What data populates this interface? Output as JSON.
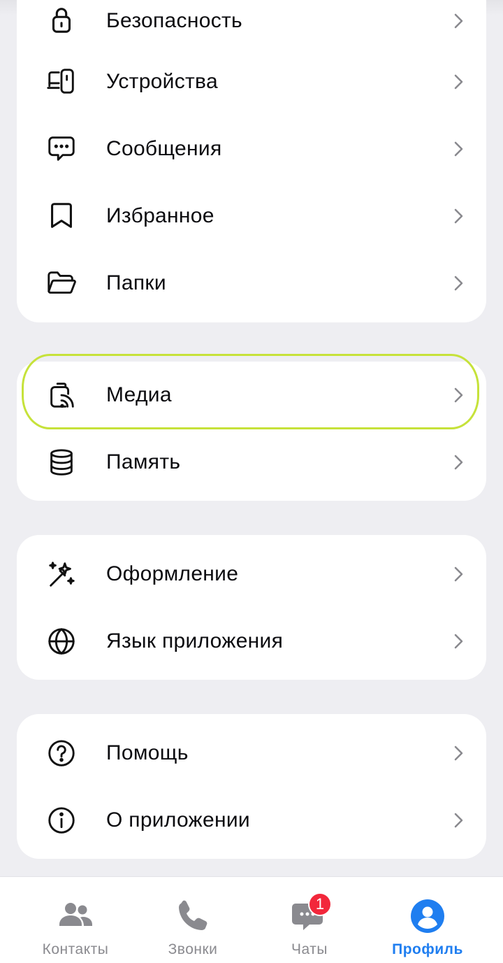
{
  "settings": {
    "group1": [
      {
        "label": "Безопасность",
        "icon": "lock-icon"
      },
      {
        "label": "Устройства",
        "icon": "devices-icon"
      },
      {
        "label": "Сообщения",
        "icon": "message-icon"
      },
      {
        "label": "Избранное",
        "icon": "bookmark-icon"
      },
      {
        "label": "Папки",
        "icon": "folder-icon"
      }
    ],
    "group2": [
      {
        "label": "Медиа",
        "icon": "media-icon"
      },
      {
        "label": "Память",
        "icon": "storage-icon"
      }
    ],
    "group3": [
      {
        "label": "Оформление",
        "icon": "magic-wand-icon"
      },
      {
        "label": "Язык приложения",
        "icon": "globe-icon"
      }
    ],
    "group4": [
      {
        "label": "Помощь",
        "icon": "help-icon"
      },
      {
        "label": "О приложении",
        "icon": "info-icon"
      }
    ]
  },
  "bottom_nav": {
    "items": [
      {
        "label": "Контакты",
        "icon": "contacts-icon"
      },
      {
        "label": "Звонки",
        "icon": "phone-icon"
      },
      {
        "label": "Чаты",
        "icon": "chats-icon",
        "badge": "1"
      },
      {
        "label": "Профиль",
        "icon": "profile-icon",
        "active": true
      }
    ]
  },
  "colors": {
    "accent": "#1f7ef0",
    "badge": "#f2273b",
    "highlight": "#c6e23a",
    "background": "#eeeef2"
  }
}
